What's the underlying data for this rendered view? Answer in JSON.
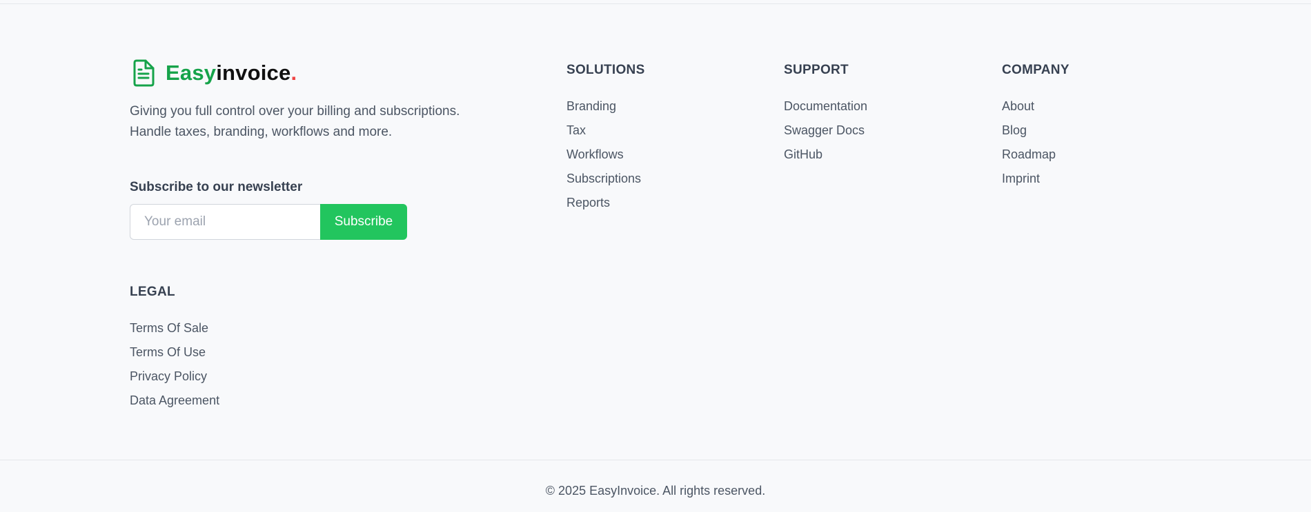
{
  "brand": {
    "icon": "document-icon",
    "name_part1": "Easy",
    "name_part2": "invoice",
    "name_dot": ".",
    "colors": {
      "accent": "#16a34a",
      "dot": "#ef4444"
    }
  },
  "tagline": "Giving you full control over your billing and subscriptions. Handle taxes, branding, workflows and more.",
  "newsletter": {
    "title": "Subscribe to our newsletter",
    "email_placeholder": "Your email",
    "email_value": "",
    "button_label": "Subscribe",
    "button_color": "#22c55e"
  },
  "columns": {
    "solutions": {
      "title": "SOLUTIONS",
      "links": [
        "Branding",
        "Tax",
        "Workflows",
        "Subscriptions",
        "Reports"
      ]
    },
    "support": {
      "title": "SUPPORT",
      "links": [
        "Documentation",
        "Swagger Docs",
        "GitHub"
      ]
    },
    "company": {
      "title": "COMPANY",
      "links": [
        "About",
        "Blog",
        "Roadmap",
        "Imprint"
      ]
    },
    "legal": {
      "title": "LEGAL",
      "links": [
        "Terms Of Sale",
        "Terms Of Use",
        "Privacy Policy",
        "Data Agreement"
      ]
    }
  },
  "copyright": "© 2025 EasyInvoice. All rights reserved."
}
